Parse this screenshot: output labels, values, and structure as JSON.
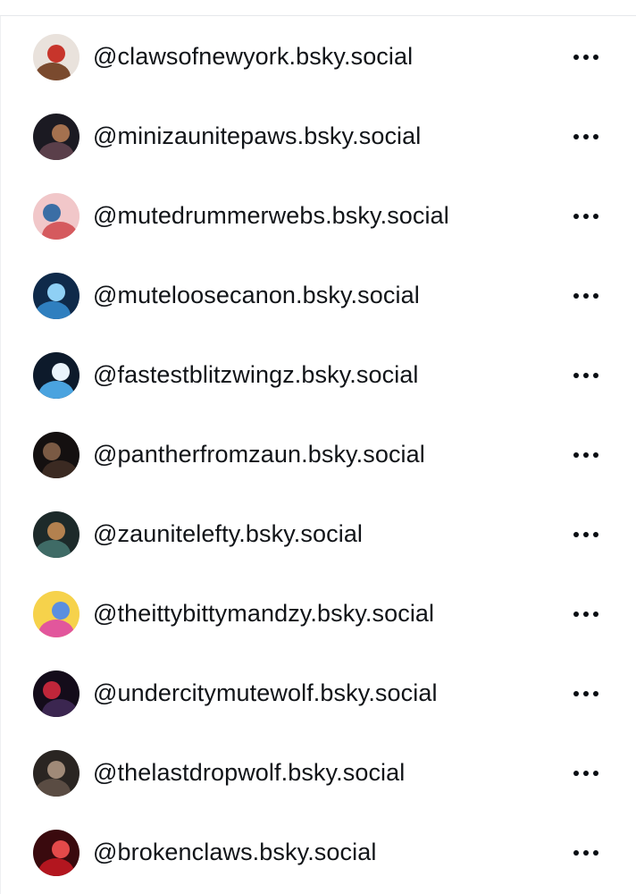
{
  "accounts": [
    {
      "handle": "@clawsofnewyork.bsky.social",
      "avatar_colors": [
        "#e9e2dc",
        "#7a4a2e",
        "#c7352b"
      ]
    },
    {
      "handle": "@minizaunitepaws.bsky.social",
      "avatar_colors": [
        "#1b1a22",
        "#5a3f4a",
        "#a4714f"
      ]
    },
    {
      "handle": "@mutedrummerwebs.bsky.social",
      "avatar_colors": [
        "#f1c7c9",
        "#d55a5e",
        "#3b6ea5"
      ]
    },
    {
      "handle": "@muteloosecanon.bsky.social",
      "avatar_colors": [
        "#0f2a4a",
        "#2f7fbf",
        "#8fd0f5"
      ]
    },
    {
      "handle": "@fastestblitzwingz.bsky.social",
      "avatar_colors": [
        "#0d1a2b",
        "#4aa3df",
        "#e9f3fb"
      ]
    },
    {
      "handle": "@pantherfromzaun.bsky.social",
      "avatar_colors": [
        "#141010",
        "#3b2a22",
        "#7a5a44"
      ]
    },
    {
      "handle": "@zaunitelefty.bsky.social",
      "avatar_colors": [
        "#1d2a2a",
        "#3f6b66",
        "#b3814f"
      ]
    },
    {
      "handle": "@theittybittymandzy.bsky.social",
      "avatar_colors": [
        "#f6d24b",
        "#e2569c",
        "#5b8fe0"
      ]
    },
    {
      "handle": "@undercitymutewolf.bsky.social",
      "avatar_colors": [
        "#140c1a",
        "#3b2650",
        "#c0263a"
      ]
    },
    {
      "handle": "@thelastdropwolf.bsky.social",
      "avatar_colors": [
        "#2a2522",
        "#5a4c43",
        "#a08a78"
      ]
    },
    {
      "handle": "@brokenclaws.bsky.social",
      "avatar_colors": [
        "#3a0a0e",
        "#b3161f",
        "#e34a4a"
      ]
    }
  ],
  "row_menu_icon": "more-horizontal-icon"
}
